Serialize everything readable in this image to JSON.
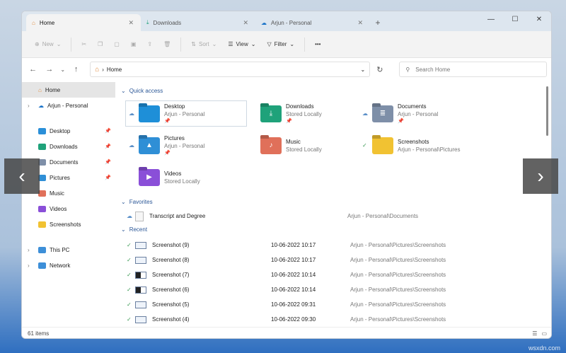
{
  "tabs": [
    {
      "label": "Home",
      "icon": "home-icon"
    },
    {
      "label": "Downloads",
      "icon": "download-icon"
    },
    {
      "label": "Arjun - Personal",
      "icon": "cloud-icon"
    }
  ],
  "toolbar": {
    "new": "New",
    "sort": "Sort",
    "view": "View",
    "filter": "Filter",
    "more": "•••"
  },
  "address": {
    "path": "Home",
    "search_placeholder": "Search Home"
  },
  "sidebar": {
    "home": "Home",
    "onedrive": "Arjun - Personal",
    "pinned": [
      {
        "label": "Desktop",
        "color": "#2a8fd8"
      },
      {
        "label": "Downloads",
        "color": "#1fa27a"
      },
      {
        "label": "Documents",
        "color": "#7e8fa8"
      },
      {
        "label": "Pictures",
        "color": "#2f8fd6"
      },
      {
        "label": "Music",
        "color": "#e0705a"
      },
      {
        "label": "Videos",
        "color": "#8a4fd8"
      },
      {
        "label": "Screenshots",
        "color": "#f1c232"
      }
    ],
    "thispc": "This PC",
    "network": "Network"
  },
  "quick_access": {
    "title": "Quick access",
    "items": [
      {
        "name": "Desktop",
        "sub": "Arjun - Personal",
        "pinned": true,
        "cloud": "☁",
        "color": "#1e8fd8",
        "glyph": ""
      },
      {
        "name": "Downloads",
        "sub": "Stored Locally",
        "pinned": true,
        "cloud": "",
        "color": "#1fa27a",
        "glyph": "⤓"
      },
      {
        "name": "Documents",
        "sub": "Arjun - Personal",
        "pinned": true,
        "cloud": "☁",
        "color": "#7e8fa8",
        "glyph": "≣"
      },
      {
        "name": "Pictures",
        "sub": "Arjun - Personal",
        "pinned": true,
        "cloud": "☁",
        "color": "#2f8fd6",
        "glyph": "▲"
      },
      {
        "name": "Music",
        "sub": "Stored Locally",
        "pinned": false,
        "cloud": "",
        "color": "#e0705a",
        "glyph": "♪"
      },
      {
        "name": "Screenshots",
        "sub": "Arjun - Personal\\Pictures",
        "pinned": false,
        "cloud": "✓",
        "color": "#f1c232",
        "glyph": ""
      },
      {
        "name": "Videos",
        "sub": "Stored Locally",
        "pinned": false,
        "cloud": "",
        "color": "#8a4fd8",
        "glyph": "▶"
      }
    ]
  },
  "favorites": {
    "title": "Favorites",
    "items": [
      {
        "name": "Transcript and Degree",
        "location": "Arjun - Personal\\Documents"
      }
    ]
  },
  "recent": {
    "title": "Recent",
    "items": [
      {
        "name": "Screenshot (9)",
        "date": "10-06-2022 10:17",
        "location": "Arjun - Personal\\Pictures\\Screenshots"
      },
      {
        "name": "Screenshot (8)",
        "date": "10-06-2022 10:17",
        "location": "Arjun - Personal\\Pictures\\Screenshots"
      },
      {
        "name": "Screenshot (7)",
        "date": "10-06-2022 10:14",
        "location": "Arjun - Personal\\Pictures\\Screenshots"
      },
      {
        "name": "Screenshot (6)",
        "date": "10-06-2022 10:14",
        "location": "Arjun - Personal\\Pictures\\Screenshots"
      },
      {
        "name": "Screenshot (5)",
        "date": "10-06-2022 09:31",
        "location": "Arjun - Personal\\Pictures\\Screenshots"
      },
      {
        "name": "Screenshot (4)",
        "date": "10-06-2022 09:30",
        "location": "Arjun - Personal\\Pictures\\Screenshots"
      }
    ]
  },
  "status": {
    "count": "61 items"
  },
  "watermark": "wsxdn.com"
}
